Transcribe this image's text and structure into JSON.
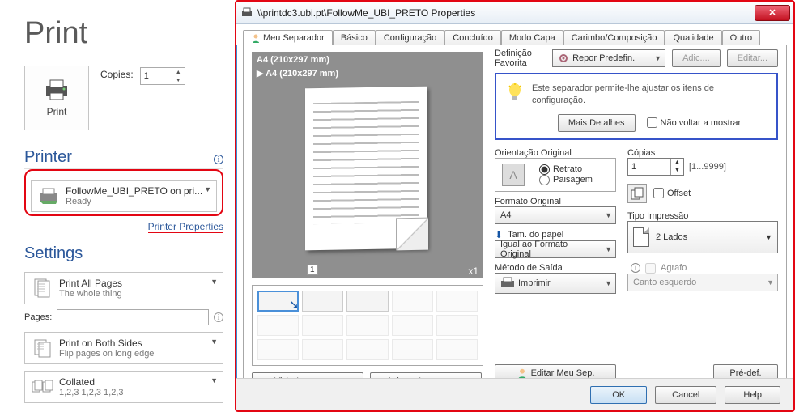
{
  "print_panel": {
    "title": "Print",
    "print_button": "Print",
    "copies_label": "Copies:",
    "copies_value": "1",
    "printer_head": "Printer",
    "printer_name": "FollowMe_UBI_PRETO on pri...",
    "printer_status": "Ready",
    "printer_props": "Printer Properties",
    "settings_head": "Settings",
    "opt1_l1": "Print All Pages",
    "opt1_l2": "The whole thing",
    "pages_label": "Pages:",
    "opt2_l1": "Print on Both Sides",
    "opt2_l2": "Flip pages on long edge",
    "opt3_l1": "Collated",
    "opt3_l2": "1,2,3   1,2,3   1,2,3"
  },
  "dialog": {
    "title": "\\\\printdc3.ubi.pt\\FollowMe_UBI_PRETO Properties",
    "tabs": [
      "Meu Separador",
      "Básico",
      "Configuração",
      "Concluído",
      "Modo Capa",
      "Carimbo/Composição",
      "Qualidade",
      "Outro"
    ],
    "fav_label": "Definição Favorita",
    "fav_value": "Repor Predefin.",
    "fav_add": "Adic....",
    "fav_edit": "Editar...",
    "preview_line1": "A4 (210x297 mm)",
    "preview_line2": "A4 (210x297 mm)",
    "preview_mult": "x1",
    "preview_pageno": "1",
    "btn_vista": "Vista Impressora",
    "btn_inform": "Inform. Impressora",
    "info_text": "Este separador permite-lhe ajustar os itens de configuração.",
    "mais_detalhes": "Mais Detalhes",
    "nao_voltar": "Não voltar a mostrar",
    "orient_label": "Orientação Original",
    "orient_portrait": "Retrato",
    "orient_landscape": "Paisagem",
    "formato_label": "Formato Original",
    "formato_value": "A4",
    "tam_label": "Tam. do papel",
    "tam_value": "Igual ao Formato Original",
    "metodo_label": "Método de Saída",
    "metodo_value": "Imprimir",
    "copias_label": "Cópias",
    "copias_value": "1",
    "copias_hint": "[1...9999]",
    "offset_label": "Offset",
    "tipo_label": "Tipo Impressão",
    "tipo_value": "2 Lados",
    "agrafo_label": "Agrafo",
    "agrafo_value": "Canto esquerdo",
    "editar_sep": "Editar Meu Sep.",
    "predef": "Pré-def.",
    "ok": "OK",
    "cancel": "Cancel",
    "help": "Help"
  }
}
